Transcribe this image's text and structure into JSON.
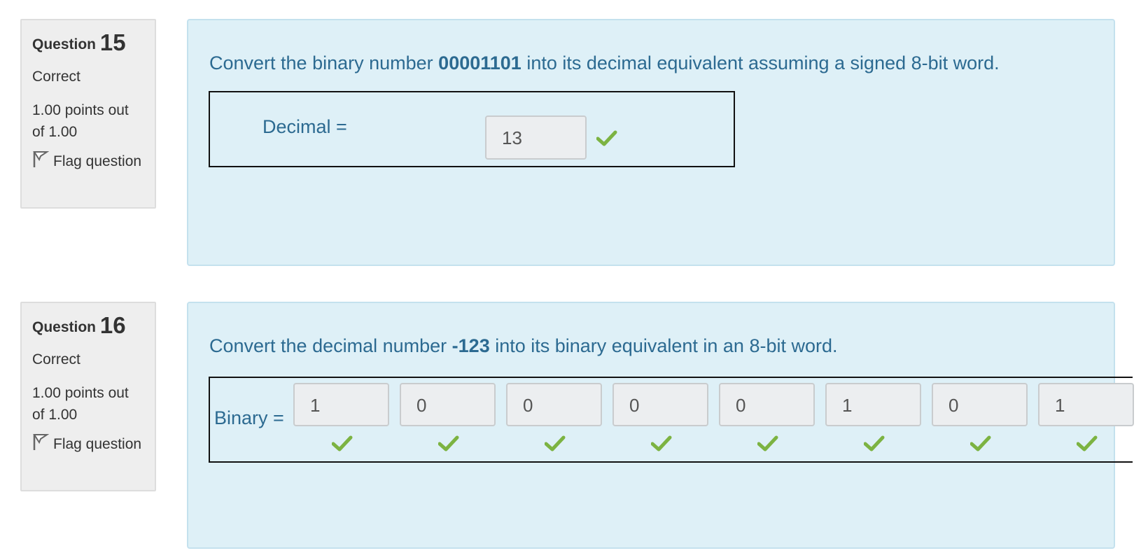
{
  "questions": [
    {
      "label": "Question",
      "number": "15",
      "state": "Correct",
      "grade": "1.00 points out of 1.00",
      "flag": "Flag question",
      "text_prefix": "Convert the binary number ",
      "text_bold": "00001101",
      "text_suffix": " into its decimal equivalent assuming a signed 8-bit word.",
      "answer_label": "Decimal =",
      "answer_value": "13"
    },
    {
      "label": "Question",
      "number": "16",
      "state": "Correct",
      "grade": "1.00 points out of 1.00",
      "flag": "Flag question",
      "text_prefix": "Convert the decimal number ",
      "text_bold": "-123",
      "text_suffix": " into its binary equivalent in an 8-bit word.",
      "answer_label": "Binary =",
      "bits": [
        "1",
        "0",
        "0",
        "0",
        "0",
        "1",
        "0",
        "1"
      ]
    }
  ],
  "colors": {
    "text_blue": "#2c6a91",
    "content_bg": "#def0f7",
    "check_green": "#7cb342"
  },
  "icons": {
    "flag": "flag-icon",
    "correct": "check-icon"
  }
}
